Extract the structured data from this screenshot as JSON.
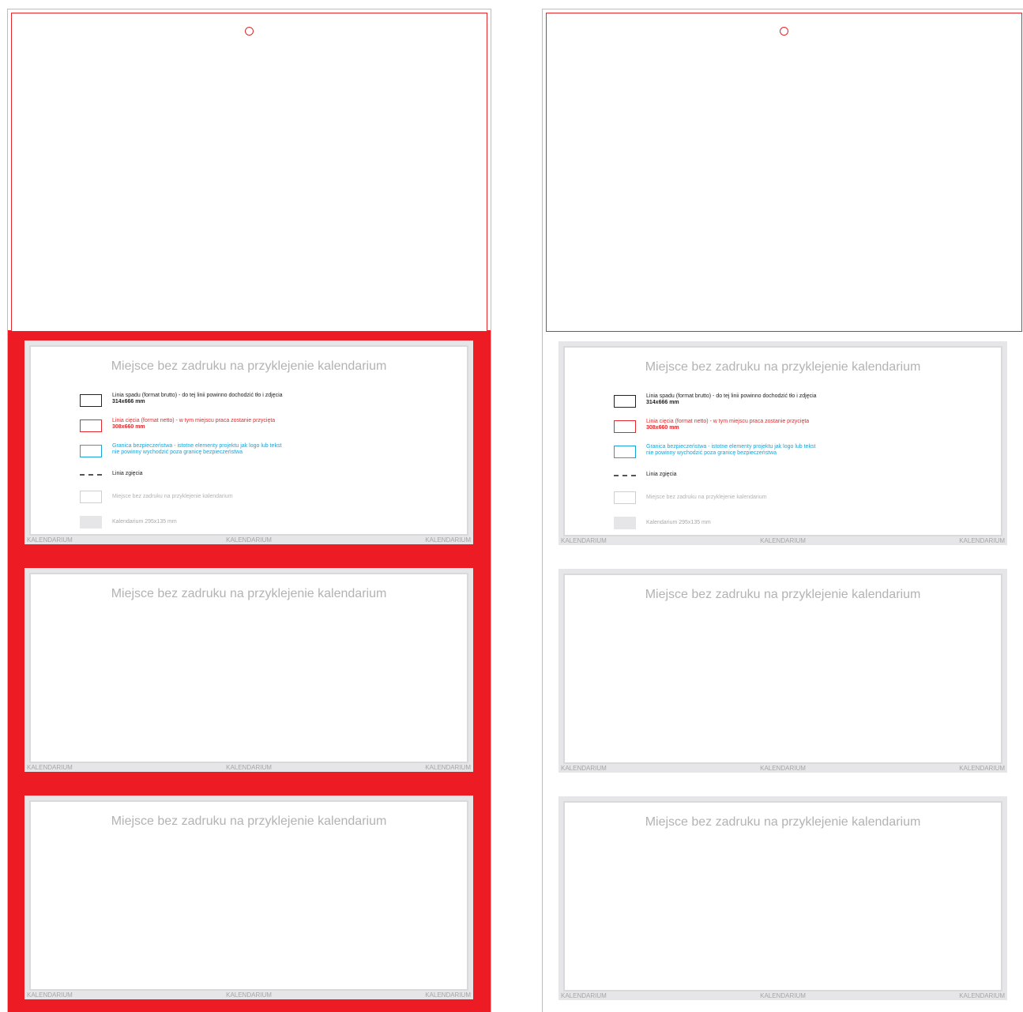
{
  "panels": [
    {
      "title": "Miejsce bez zadruku na przyklejenie kalendarium"
    },
    {
      "title": "Miejsce bez zadruku na przyklejenie kalendarium"
    },
    {
      "title": "Miejsce bez zadruku na przyklejenie kalendarium"
    }
  ],
  "footer_label": "KALENDARIUM",
  "legend": {
    "bleed_text": "Linia spadu (format brutto) - do tej linii powinno dochodzić tło i zdjęcia",
    "bleed_size": "314x666 mm",
    "cut_text": "Linia cięcia (format netto) - w tym miejscu praca zostanie przycięta",
    "cut_size": "308x660 mm",
    "safety_text_1": "Granica bezpieczeństwa - istotne elementy projektu jak logo lub tekst",
    "safety_text_2": "nie powinny wychodzić poza granicę bezpieczeństwa",
    "fold_text": "Linia zgięcia",
    "blank_area_text": "Miejsce bez zadruku na przyklejenie kalendarium",
    "calendar_text": "Kalendarium 295x135 mm"
  },
  "colors": {
    "cut_line": "#e4282c",
    "highlight": "#ed1c24",
    "safety": "#1aa3d8",
    "panel_grey": "#e6e6e8"
  }
}
